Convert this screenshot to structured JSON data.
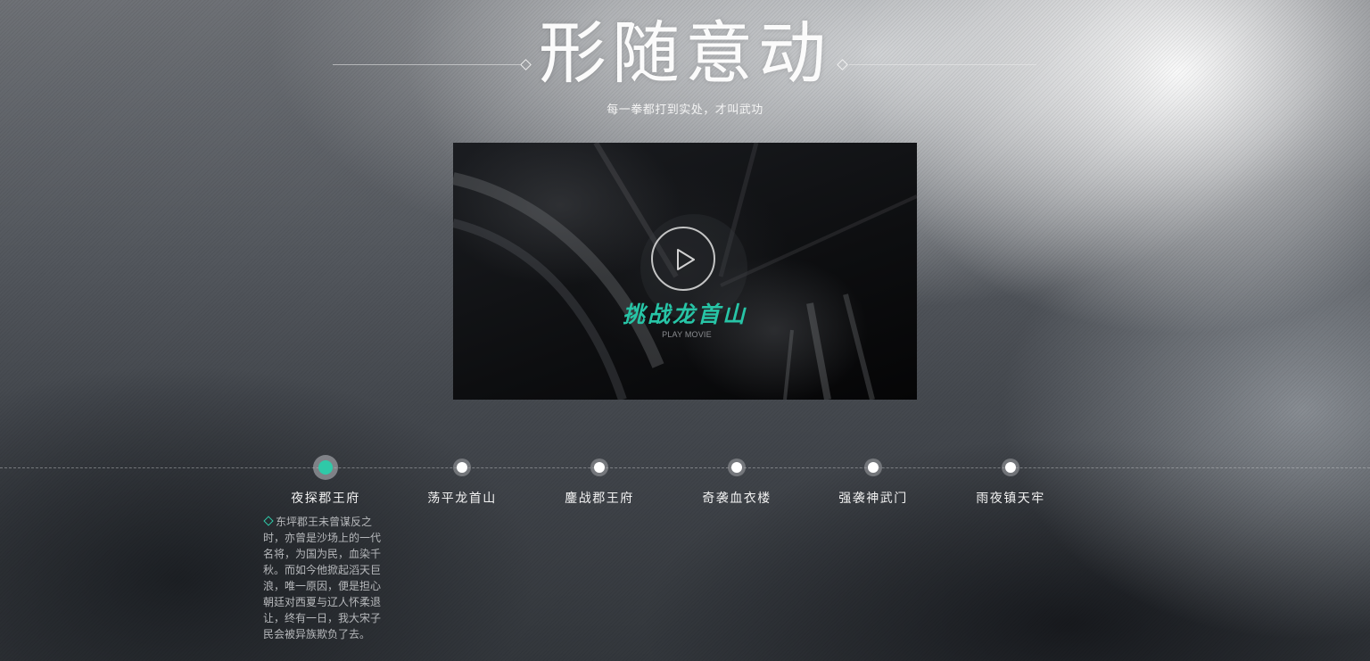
{
  "header": {
    "title": "形随意动",
    "subtitle": "每一拳都打到实处，才叫武功"
  },
  "video": {
    "caption": "挑战龙首山",
    "play_label": "PLAY MOVIE"
  },
  "timeline": {
    "active_index": 0,
    "accent_color": "#2fc9a8",
    "items": [
      {
        "label": "夜探郡王府"
      },
      {
        "label": "荡平龙首山"
      },
      {
        "label": "鏖战郡王府"
      },
      {
        "label": "奇袭血衣楼"
      },
      {
        "label": "强袭神武门"
      },
      {
        "label": "雨夜镇天牢"
      }
    ],
    "description": "东坪郡王未曾谋反之时，亦曾是沙场上的一代名将，为国为民，血染千秋。而如今他掀起滔天巨浪，唯一原因，便是担心朝廷对西夏与辽人怀柔退让，终有一日，我大宋子民会被异族欺负了去。"
  },
  "icons": {
    "play": "play-icon",
    "description_marker": "diamond-icon"
  }
}
